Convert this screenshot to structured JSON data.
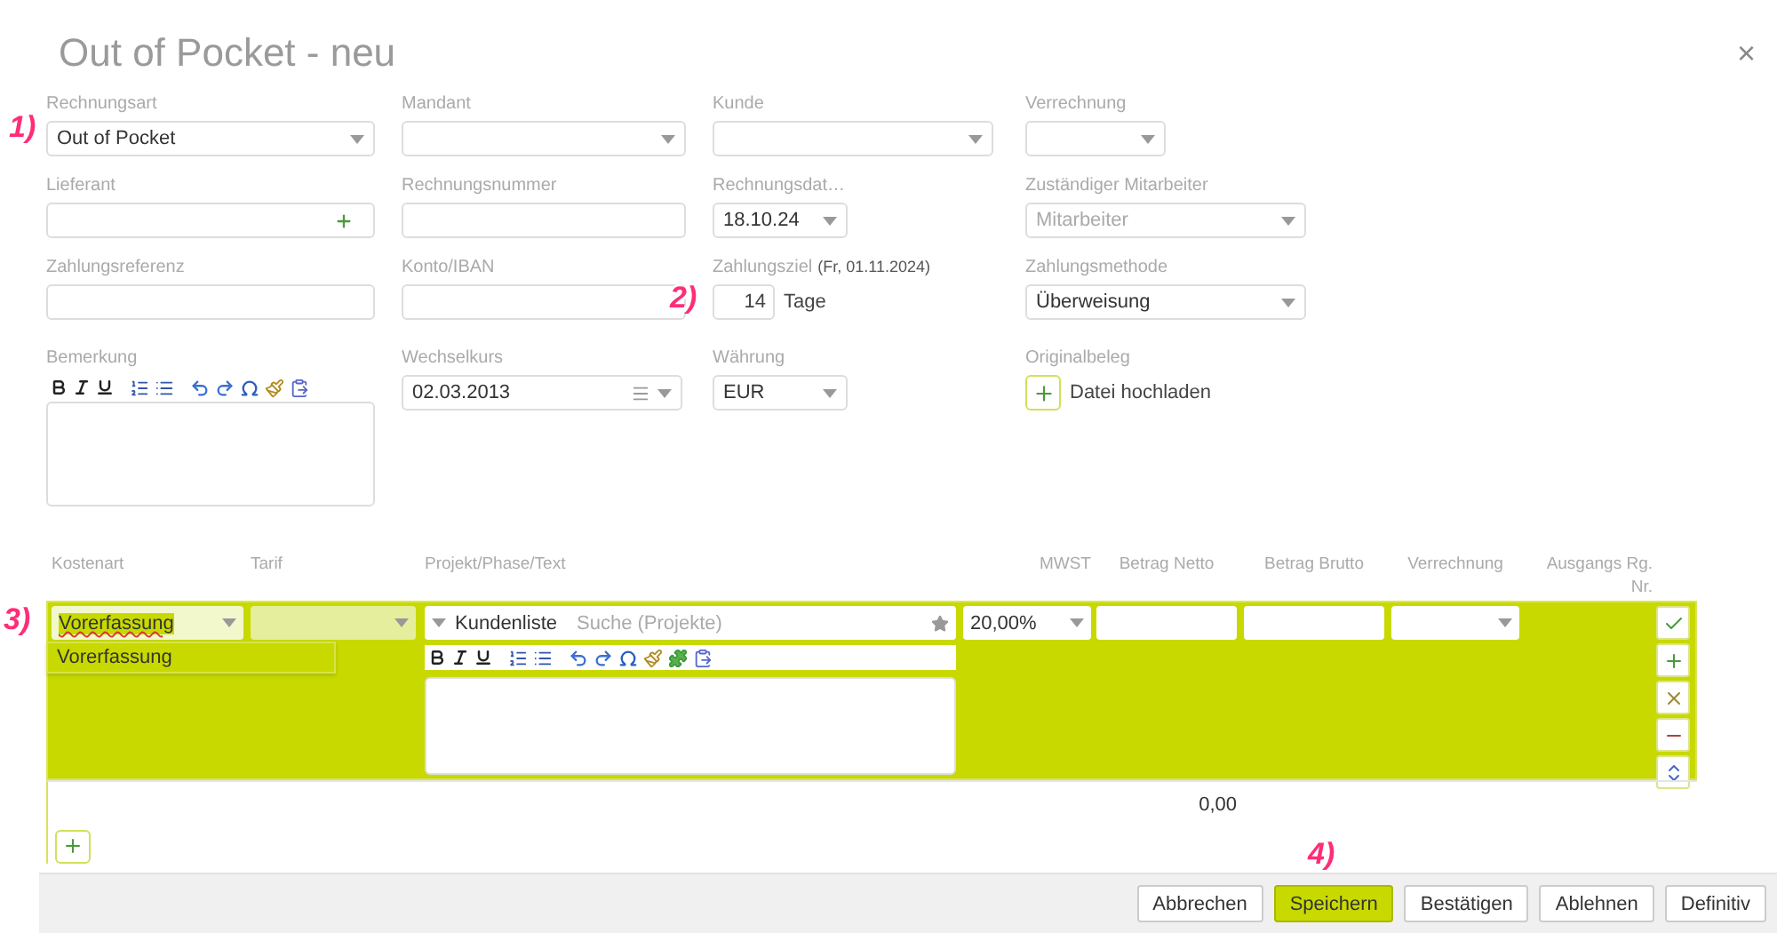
{
  "dialog": {
    "title": "Out of Pocket - neu",
    "close": "×"
  },
  "form": {
    "rechnungsart": {
      "label": "Rechnungsart",
      "value": "Out of Pocket"
    },
    "mandant": {
      "label": "Mandant"
    },
    "kunde": {
      "label": "Kunde"
    },
    "verrechnung": {
      "label": "Verrechnung"
    },
    "lieferant": {
      "label": "Lieferant"
    },
    "rechnungsnummer": {
      "label": "Rechnungsnummer"
    },
    "rechnungsdatum": {
      "label": "Rechnungsdat…",
      "value": "18.10.24"
    },
    "mitarbeiter": {
      "label": "Zuständiger Mitarbeiter",
      "placeholder": "Mitarbeiter"
    },
    "zahlungsreferenz": {
      "label": "Zahlungsreferenz"
    },
    "konto": {
      "label": "Konto/IBAN"
    },
    "zahlungsziel": {
      "label": "Zahlungsziel",
      "date": "(Fr, 01.11.2024)",
      "value": "14",
      "unit": "Tage"
    },
    "zahlungsmethode": {
      "label": "Zahlungsmethode",
      "value": "Überweisung"
    },
    "bemerkung": {
      "label": "Bemerkung"
    },
    "wechselkurs": {
      "label": "Wechselkurs",
      "value": "02.03.2013"
    },
    "waehrung": {
      "label": "Währung",
      "value": "EUR"
    },
    "originalbeleg": {
      "label": "Originalbeleg",
      "upload": "Datei hochladen"
    }
  },
  "positions": {
    "columns": [
      "Kostenart",
      "Tarif",
      "Projekt/Phase/Text",
      "MWST",
      "Betrag Netto",
      "Betrag Brutto",
      "Verrechnung",
      "Ausgangs Rg. Nr."
    ],
    "row": {
      "kostenart": "Vorerfassung",
      "expanded": true,
      "options": [
        "Vorerfassung"
      ],
      "projekt_mode": "Kundenliste",
      "projekt_placeholder": "Suche (Projekte)",
      "mwst": "20,00%"
    },
    "total": "0,00"
  },
  "buttons": [
    {
      "label": "Abbrechen",
      "kind": "default"
    },
    {
      "label": "Speichern",
      "kind": "primary"
    },
    {
      "label": "Bestätigen",
      "kind": "default"
    },
    {
      "label": "Ablehnen",
      "kind": "default"
    },
    {
      "label": "Definitiv",
      "kind": "default"
    }
  ],
  "annotations": [
    "1)",
    "2)",
    "3)",
    "4)"
  ]
}
